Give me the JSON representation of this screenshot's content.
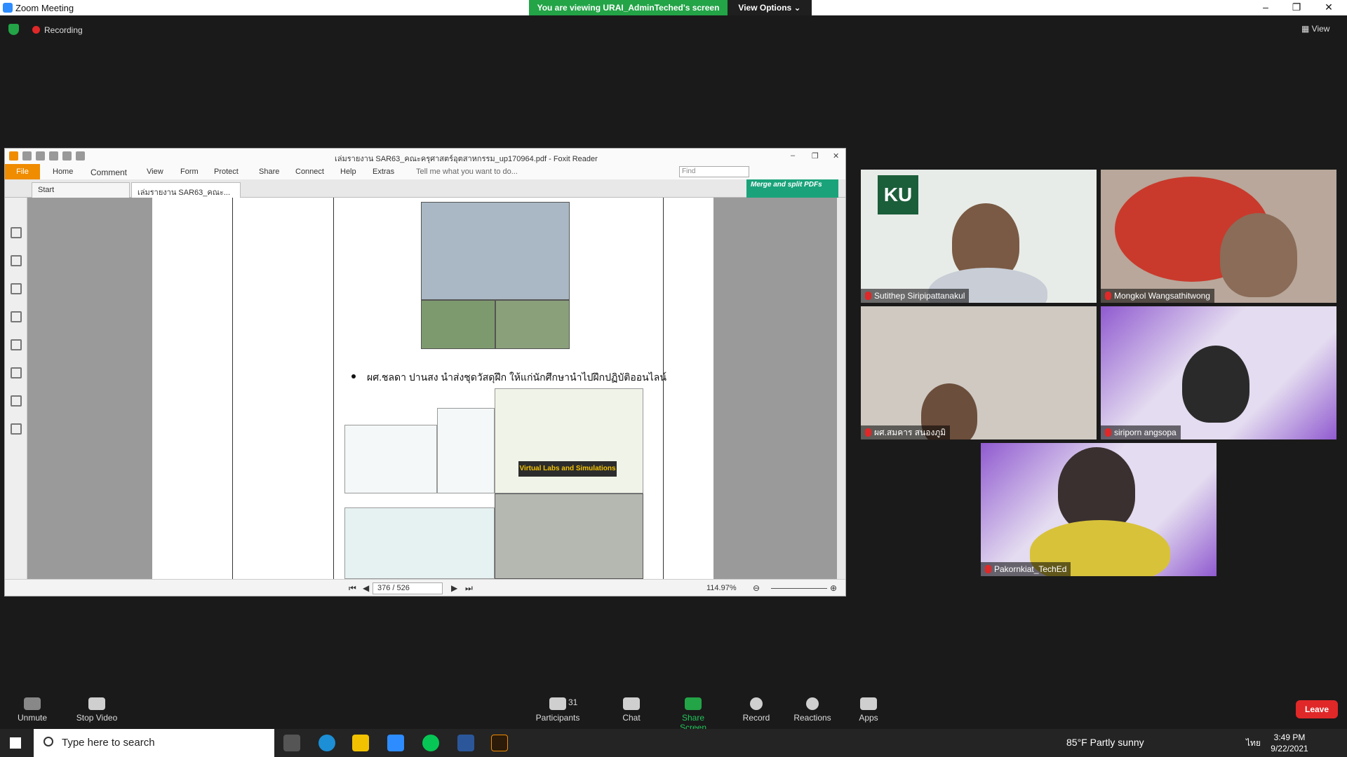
{
  "window": {
    "title": "Zoom Meeting",
    "viewing_banner": "You are viewing URAI_AdminTeched's screen",
    "view_options": "View Options ⌄",
    "minimize": "–",
    "maximize": "❐",
    "close": "✕"
  },
  "recording": {
    "label": "Recording"
  },
  "view_button": "▦ View",
  "foxit": {
    "doc_title": "เล่มรายงาน SAR63_คณะครุศาสตร์อุตสาหกรรม_up170964.pdf - Foxit Reader",
    "menu": [
      "File",
      "Home",
      "Comment",
      "View",
      "Form",
      "Protect",
      "Share",
      "Connect",
      "Help",
      "Extras"
    ],
    "tell_me": "Tell me what you want to do...",
    "find_placeholder": "Find",
    "tabs": [
      "Start",
      "เล่มรายงาน SAR63_คณะ..."
    ],
    "merge_banner": "Merge and split PDFs",
    "bullet_text": "ผศ.ชลดา ปานสง นำส่งชุดวัสดุฝึก ให้แก่นักศึกษานำไปฝึกปฏิบัติออนไลน์",
    "vlab_label": "Virtual Labs and Simulations",
    "page_indicator": "376 / 526",
    "zoom": "114.97%"
  },
  "participants": [
    {
      "name": "Sutithep Siripipattanakul"
    },
    {
      "name": "Mongkol Wangsathitwong"
    },
    {
      "name": "ผศ.สมคาร  สนองภูมิ"
    },
    {
      "name": "siriporn angsopa"
    },
    {
      "name": "Pakornkiat_TechEd"
    }
  ],
  "toolbar": {
    "unmute": "Unmute",
    "stop_video": "Stop Video",
    "participants": "Participants",
    "participant_count": "31",
    "chat": "Chat",
    "share_screen": "Share Screen",
    "record": "Record",
    "reactions": "Reactions",
    "apps": "Apps",
    "leave": "Leave"
  },
  "taskbar": {
    "search_placeholder": "Type here to search",
    "weather": "85°F  Partly sunny",
    "language": "ไทย",
    "time": "3:49 PM",
    "date": "9/22/2021"
  },
  "colors": {
    "zoom_blue": "#2D8CFF",
    "viewing_green": "#23a447",
    "leave_red": "#e02828",
    "foxit_orange": "#f08c00"
  }
}
